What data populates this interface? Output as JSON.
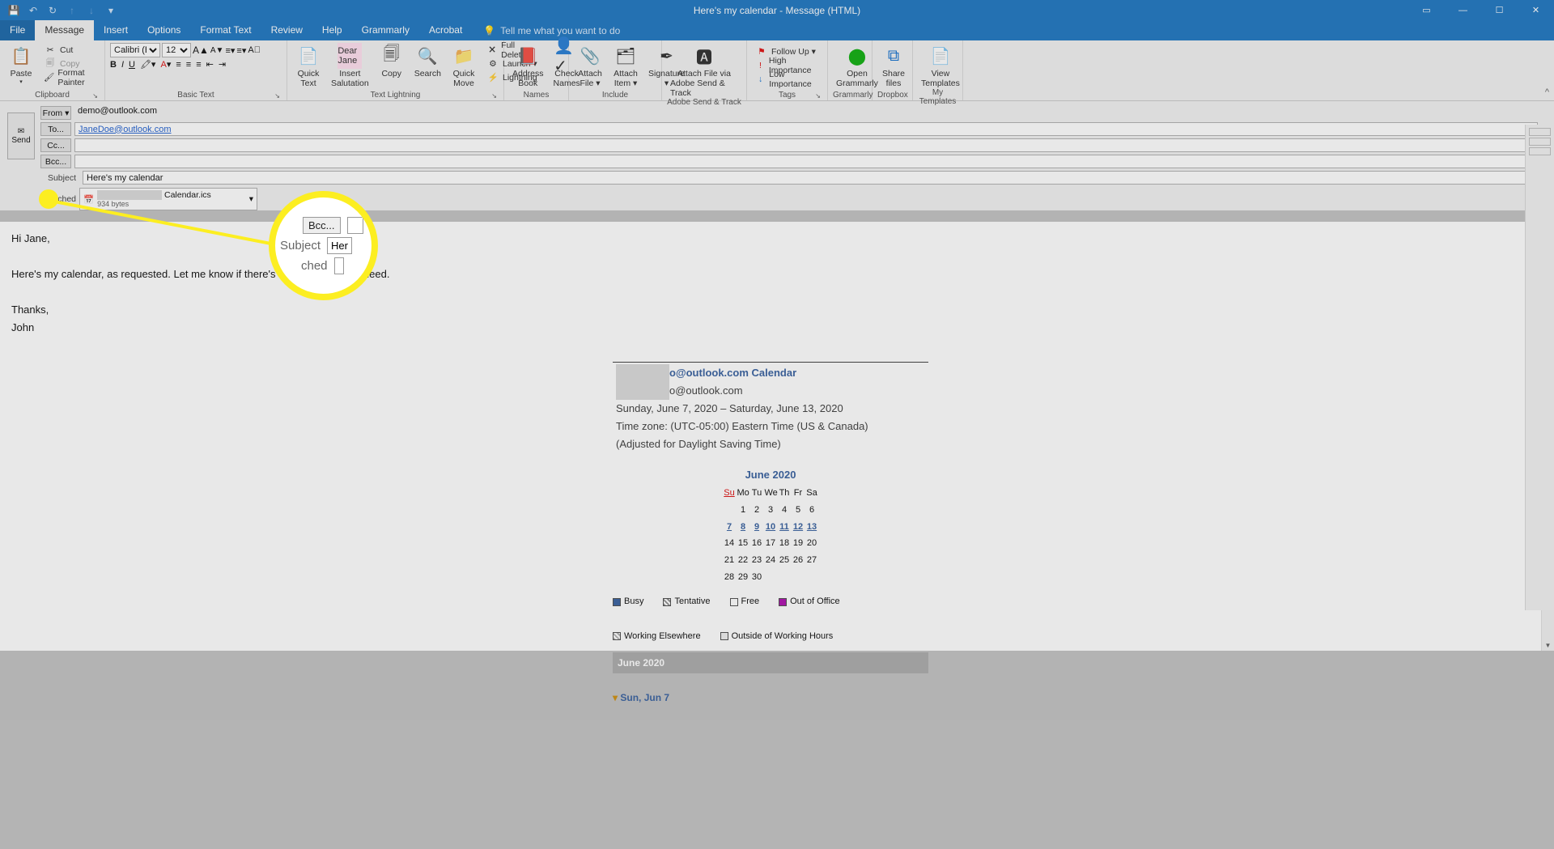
{
  "window": {
    "title": "Here's my calendar - Message (HTML)"
  },
  "menu": {
    "file": "File",
    "message": "Message",
    "insert": "Insert",
    "options": "Options",
    "formatText": "Format Text",
    "review": "Review",
    "help": "Help",
    "grammarly": "Grammarly",
    "acrobat": "Acrobat",
    "tellMe": "Tell me what you want to do"
  },
  "ribbon": {
    "clipboard": {
      "paste": "Paste",
      "cut": "Cut",
      "copy": "Copy",
      "formatPainter": "Format Painter",
      "label": "Clipboard"
    },
    "basicText": {
      "font": "Calibri (B",
      "size": "12",
      "label": "Basic Text"
    },
    "textLightning": {
      "quickText": "Quick",
      "quickText2": "Text",
      "insertSal": "Insert",
      "insertSal2": "Salutation",
      "copy": "Copy",
      "search": "Search",
      "quickMove": "Quick",
      "quickMove2": "Move",
      "fullDelete": "Full Delete",
      "launch": "Launch ▾",
      "lightning": "Lightning",
      "label": "Text Lightning"
    },
    "names": {
      "address": "Address",
      "address2": "Book",
      "check": "Check",
      "check2": "Names",
      "label": "Names"
    },
    "include": {
      "attachFile": "Attach",
      "attachFile2": "File ▾",
      "attachItem": "Attach",
      "attachItem2": "Item ▾",
      "signature": "Signature",
      "signature2": "▾",
      "label": "Include"
    },
    "adobe": {
      "line1": "Attach File via",
      "line2": "Adobe Send & Track",
      "label": "Adobe Send & Track"
    },
    "tags": {
      "followUp": "Follow Up ▾",
      "high": "High Importance",
      "low": "Low Importance",
      "label": "Tags"
    },
    "grammarly": {
      "open": "Open",
      "open2": "Grammarly",
      "label": "Grammarly"
    },
    "dropbox": {
      "share": "Share",
      "share2": "files",
      "label": "Dropbox"
    },
    "templates": {
      "view": "View",
      "view2": "Templates",
      "label": "My Templates"
    }
  },
  "compose": {
    "send": "Send",
    "from": "From ▾",
    "fromVal": "demo@outlook.com",
    "from2Val": "",
    "to": "To...",
    "toVal": "JaneDoe@outlook.com",
    "cc": "Cc...",
    "bcc": "Bcc...",
    "subjectLbl": "Subject",
    "subjectVal": "Here's my calendar",
    "attachedLbl": "Attached",
    "attachName": "Calendar.ics",
    "attachSize": "934 bytes"
  },
  "body": {
    "l1": "Hi Jane,",
    "l2": "Here's my calendar, as requested. Let me know if there's anything else you need.",
    "l3": "Thanks,",
    "l4": "John"
  },
  "cal": {
    "title": "o@outlook.com Calendar",
    "sub1": "o@outlook.com",
    "range": "Sunday, June 7, 2020 – Saturday, June 13, 2020",
    "tz": "Time zone: (UTC-05:00) Eastern Time (US & Canada)",
    "adj": "(Adjusted for Daylight Saving Time)",
    "month": "June 2020",
    "dayhdrs": [
      "Su",
      "Mo",
      "Tu",
      "We",
      "Th",
      "Fr",
      "Sa"
    ],
    "w1": [
      "",
      "1",
      "2",
      "3",
      "4",
      "5",
      "6"
    ],
    "w2": [
      "7",
      "8",
      "9",
      "10",
      "11",
      "12",
      "13"
    ],
    "w3": [
      "14",
      "15",
      "16",
      "17",
      "18",
      "19",
      "20"
    ],
    "w4": [
      "21",
      "22",
      "23",
      "24",
      "25",
      "26",
      "27"
    ],
    "w5": [
      "28",
      "29",
      "30",
      "",
      "",
      "",
      ""
    ],
    "leg": {
      "busy": "Busy",
      "tent": "Tentative",
      "free": "Free",
      "ooo": "Out of Office",
      "we": "Working Elsewhere",
      "owh": "Outside of Working Hours"
    },
    "bar": "June 2020",
    "day": "Sun, Jun 7"
  },
  "zoom": {
    "bcc": "Bcc...",
    "subject": "Subject",
    "her": "Her",
    "ched": "ched"
  }
}
